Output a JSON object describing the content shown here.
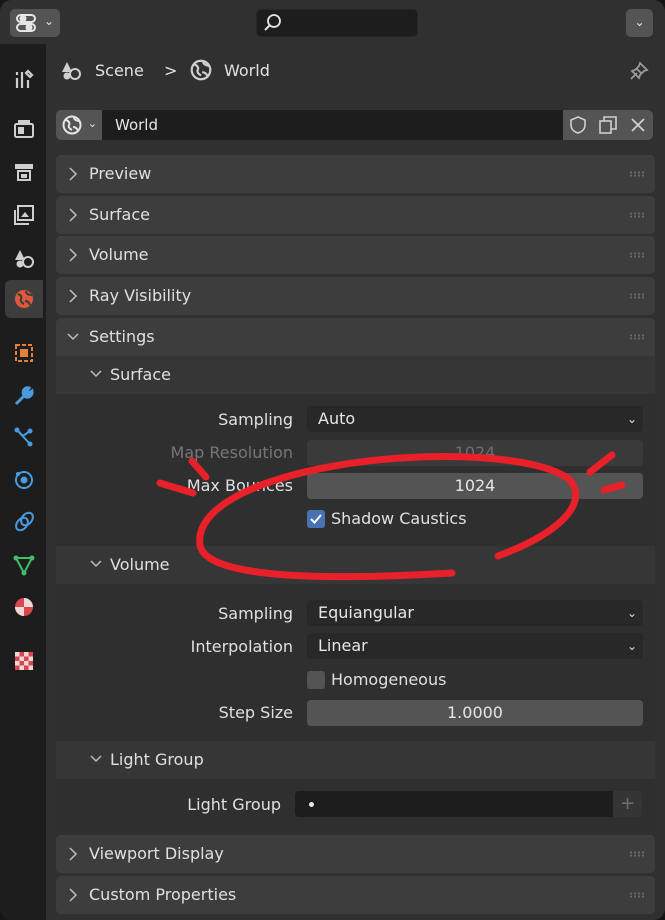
{
  "header": {
    "search_placeholder": "",
    "editor_type_icon": "properties-editor-icon"
  },
  "breadcrumb": {
    "scene": "Scene",
    "separator": ">",
    "world": "World"
  },
  "datablock": {
    "name": "World"
  },
  "panels": {
    "preview": "Preview",
    "surface": "Surface",
    "volume": "Volume",
    "ray_visibility": "Ray Visibility",
    "settings": "Settings",
    "viewport_display": "Viewport Display",
    "custom_properties": "Custom Properties"
  },
  "settings": {
    "surface": {
      "title": "Surface",
      "sampling_label": "Sampling",
      "sampling_value": "Auto",
      "map_resolution_label": "Map Resolution",
      "map_resolution_value": "1024",
      "max_bounces_label": "Max Bounces",
      "max_bounces_value": "1024",
      "shadow_caustics_label": "Shadow Caustics",
      "shadow_caustics_checked": true
    },
    "volume": {
      "title": "Volume",
      "sampling_label": "Sampling",
      "sampling_value": "Equiangular",
      "interpolation_label": "Interpolation",
      "interpolation_value": "Linear",
      "homogeneous_label": "Homogeneous",
      "homogeneous_checked": false,
      "step_size_label": "Step Size",
      "step_size_value": "1.0000"
    },
    "light_group": {
      "title": "Light Group",
      "field_label": "Light Group",
      "add_symbol": "+"
    }
  },
  "colors": {
    "accent": "#4772b3",
    "annotation": "#e8202a",
    "active_tab": "#e0583a"
  },
  "sidebar_tabs": [
    "tool",
    "render",
    "output",
    "view-layer",
    "scene",
    "world",
    "object",
    "modifiers",
    "particles",
    "physics",
    "constraints",
    "data",
    "material",
    "texture"
  ]
}
